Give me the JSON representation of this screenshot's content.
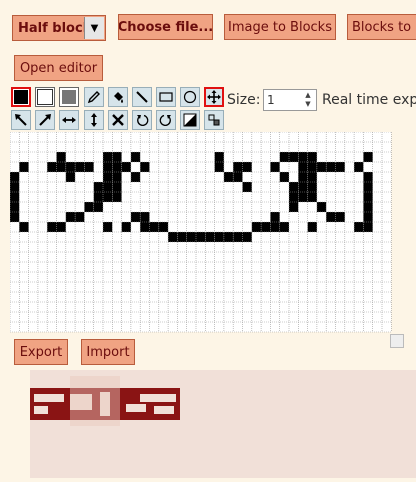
{
  "toolbar": {
    "mode_select": "Half block",
    "choose_file": "Choose file...",
    "image_to_blocks": "Image to Blocks",
    "blocks_to": "Blocks to I",
    "open_editor": "Open editor"
  },
  "editor": {
    "size_label": "Size:",
    "size_value": "1",
    "realtime_label": "Real time exp",
    "tools_row1": [
      "black-color-swatch",
      "white-color-swatch",
      "gray-color-swatch",
      "pencil-icon",
      "fill-bucket-icon",
      "line-icon",
      "rectangle-icon",
      "circle-icon",
      "move-icon"
    ],
    "tools_row2": [
      "shift-up-left-icon",
      "shift-up-right-icon",
      "flip-horizontal-icon",
      "flip-vertical-icon",
      "clear-icon",
      "rotate-ccw-icon",
      "rotate-cw-icon",
      "invert-icon",
      "crop-icon"
    ],
    "active_tool": "move-icon"
  },
  "canvas": {
    "cols": 41,
    "rows": 20,
    "filled": [
      [
        0,
        4
      ],
      [
        0,
        5
      ],
      [
        0,
        6
      ],
      [
        0,
        7
      ],
      [
        0,
        8
      ],
      [
        1,
        3
      ],
      [
        1,
        9
      ],
      [
        4,
        3
      ],
      [
        4,
        9
      ],
      [
        5,
        2
      ],
      [
        5,
        3
      ],
      [
        5,
        9
      ],
      [
        6,
        3
      ],
      [
        6,
        4
      ],
      [
        6,
        8
      ],
      [
        7,
        3
      ],
      [
        7,
        8
      ],
      [
        8,
        3
      ],
      [
        8,
        7
      ],
      [
        9,
        5
      ],
      [
        9,
        6
      ],
      [
        9,
        7
      ],
      [
        10,
        2
      ],
      [
        10,
        3
      ],
      [
        10,
        4
      ],
      [
        10,
        5
      ],
      [
        10,
        6
      ],
      [
        10,
        9
      ],
      [
        11,
        2
      ],
      [
        11,
        3
      ],
      [
        11,
        4
      ],
      [
        11,
        5
      ],
      [
        11,
        6
      ],
      [
        12,
        3
      ],
      [
        12,
        9
      ],
      [
        13,
        2
      ],
      [
        13,
        4
      ],
      [
        13,
        8
      ],
      [
        14,
        3
      ],
      [
        14,
        8
      ],
      [
        14,
        9
      ],
      [
        15,
        9
      ],
      [
        16,
        9
      ],
      [
        17,
        10
      ],
      [
        18,
        10
      ],
      [
        19,
        10
      ],
      [
        20,
        10
      ],
      [
        21,
        10
      ],
      [
        22,
        10
      ],
      [
        23,
        10
      ],
      [
        24,
        10
      ],
      [
        25,
        10
      ],
      [
        26,
        9
      ],
      [
        27,
        9
      ],
      [
        28,
        8
      ],
      [
        28,
        9
      ],
      [
        22,
        2
      ],
      [
        22,
        3
      ],
      [
        23,
        4
      ],
      [
        24,
        3
      ],
      [
        24,
        4
      ],
      [
        25,
        3
      ],
      [
        25,
        5
      ],
      [
        28,
        3
      ],
      [
        29,
        2
      ],
      [
        29,
        4
      ],
      [
        29,
        9
      ],
      [
        30,
        2
      ],
      [
        30,
        5
      ],
      [
        30,
        6
      ],
      [
        30,
        7
      ],
      [
        31,
        2
      ],
      [
        31,
        3
      ],
      [
        31,
        4
      ],
      [
        31,
        5
      ],
      [
        31,
        6
      ],
      [
        32,
        2
      ],
      [
        32,
        3
      ],
      [
        32,
        4
      ],
      [
        32,
        5
      ],
      [
        32,
        6
      ],
      [
        32,
        9
      ],
      [
        33,
        3
      ],
      [
        33,
        7
      ],
      [
        34,
        3
      ],
      [
        34,
        8
      ],
      [
        35,
        3
      ],
      [
        35,
        8
      ],
      [
        37,
        3
      ],
      [
        37,
        9
      ],
      [
        38,
        2
      ],
      [
        38,
        4
      ],
      [
        38,
        5
      ],
      [
        38,
        6
      ],
      [
        38,
        7
      ],
      [
        38,
        8
      ],
      [
        38,
        9
      ]
    ]
  },
  "bottom": {
    "export": "Export",
    "import": "Import"
  },
  "colors": {
    "button_bg": "#f0a383",
    "button_text": "#6b0d0d",
    "page_bg": "#fdf5e6",
    "preview_bg": "#f1e0d8",
    "preview_pattern": "#8a1414"
  }
}
